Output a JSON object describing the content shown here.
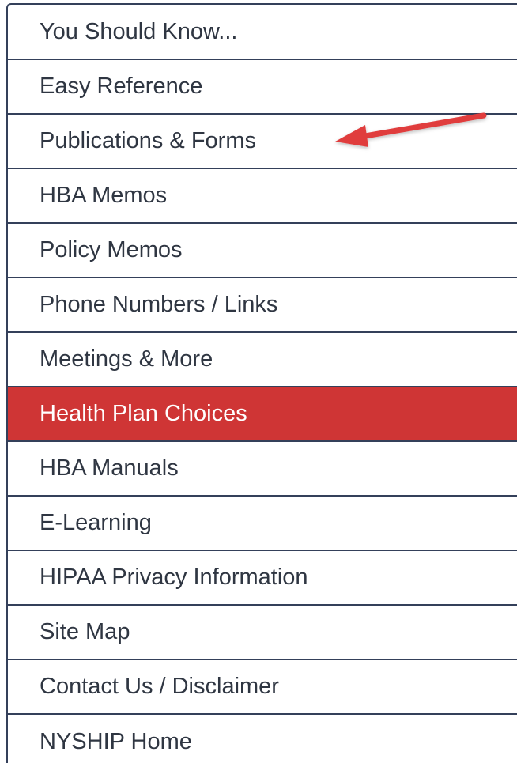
{
  "nav": {
    "items": [
      {
        "label": "You Should Know..."
      },
      {
        "label": "Easy Reference"
      },
      {
        "label": "Publications & Forms"
      },
      {
        "label": "HBA Memos"
      },
      {
        "label": "Policy Memos"
      },
      {
        "label": "Phone Numbers / Links"
      },
      {
        "label": "Meetings & More"
      },
      {
        "label": "Health Plan Choices",
        "active": true
      },
      {
        "label": "HBA Manuals"
      },
      {
        "label": "E-Learning"
      },
      {
        "label": "HIPAA Privacy Information"
      },
      {
        "label": "Site Map"
      },
      {
        "label": "Contact Us / Disclaimer"
      },
      {
        "label": "NYSHIP Home"
      }
    ]
  },
  "colors": {
    "active_bg": "#cf3535",
    "border": "#34405a",
    "text": "#2f3642",
    "annotation_arrow": "#e03c3c"
  },
  "annotation": {
    "icon": "red-arrow-icon",
    "points_to": "Publications & Forms"
  }
}
